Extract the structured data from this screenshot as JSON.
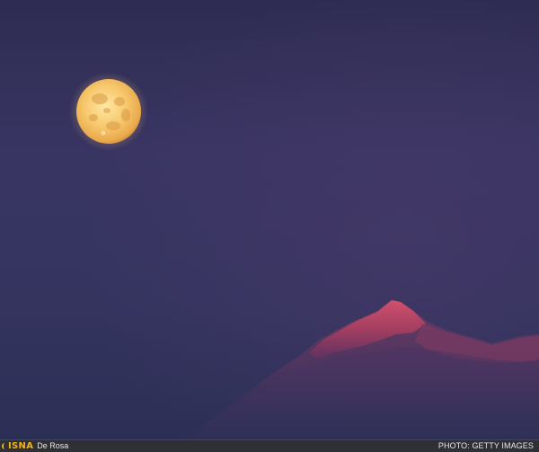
{
  "photo": {
    "subject": "",
    "sky_color": "#34325c",
    "moon_color": "#f4c46a",
    "mountain_color": "#a8405a"
  },
  "watermark": {
    "logo_text": "ISNA",
    "photographer": "De Rosa"
  },
  "credit": {
    "text": "PHOTO: GETTY IMAGES"
  }
}
